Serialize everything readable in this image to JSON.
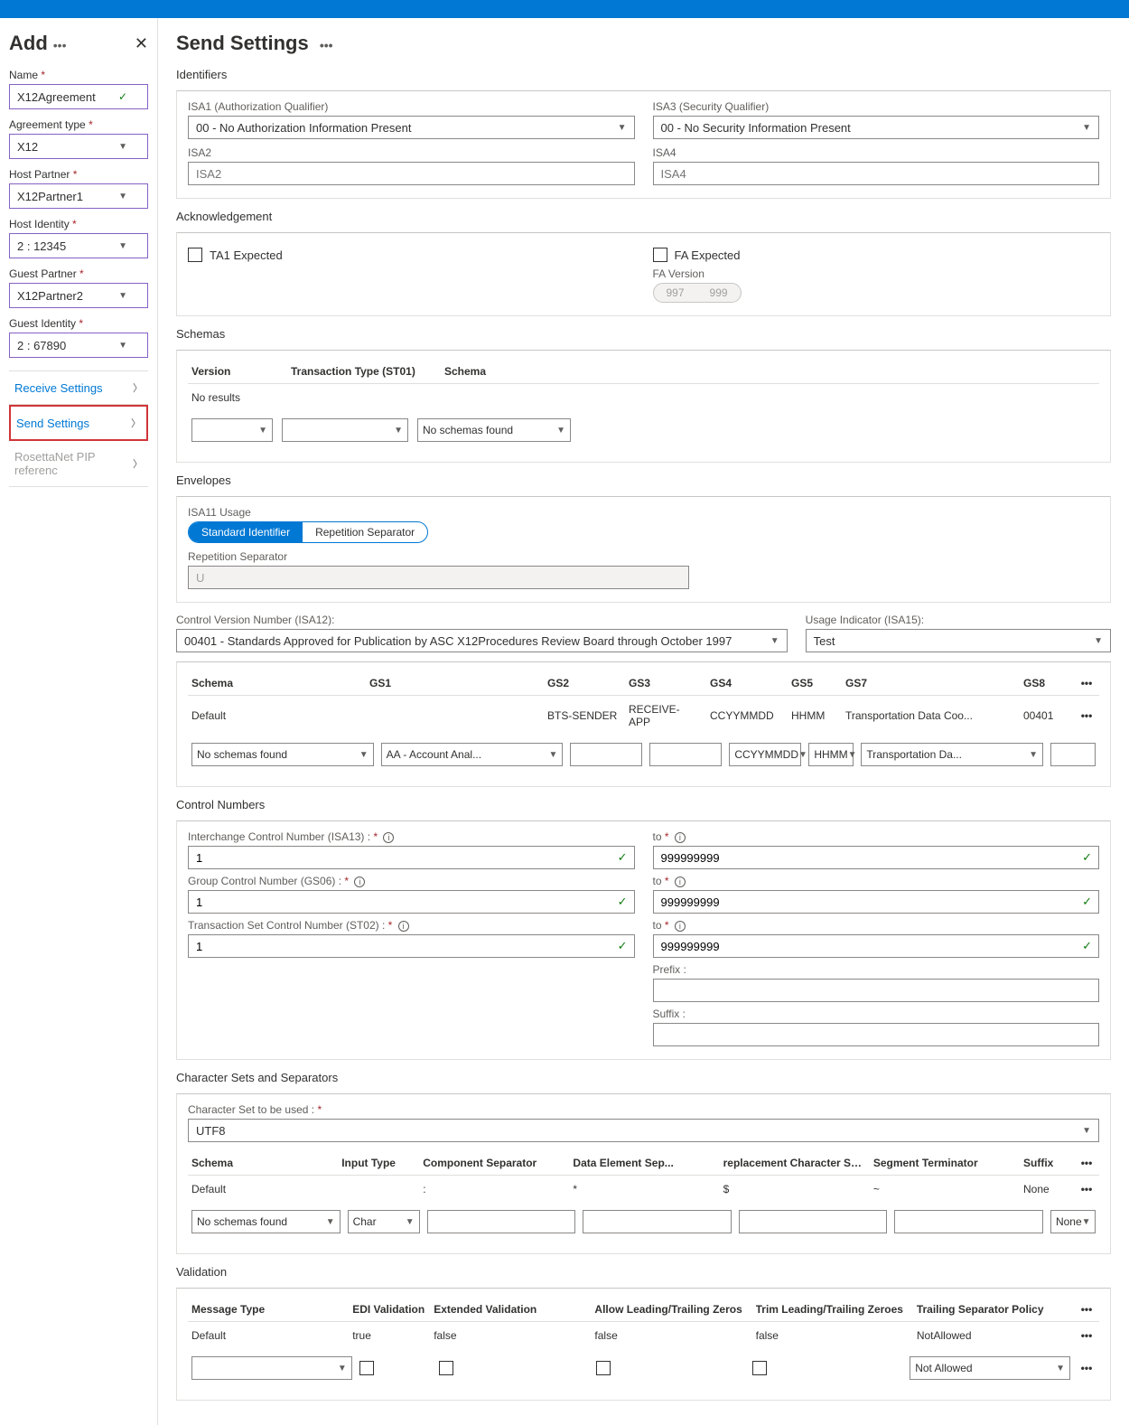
{
  "sidebar": {
    "title": "Add",
    "fields": {
      "name": {
        "label": "Name",
        "value": "X12Agreement"
      },
      "agreementType": {
        "label": "Agreement type",
        "value": "X12"
      },
      "hostPartner": {
        "label": "Host Partner",
        "value": "X12Partner1"
      },
      "hostIdentity": {
        "label": "Host Identity",
        "value": "2 : 12345"
      },
      "guestPartner": {
        "label": "Guest Partner",
        "value": "X12Partner2"
      },
      "guestIdentity": {
        "label": "Guest Identity",
        "value": "2 : 67890"
      }
    },
    "nav": {
      "receive": "Receive Settings",
      "send": "Send Settings",
      "rosetta": "RosettaNet PIP referenc"
    }
  },
  "page": {
    "title": "Send Settings"
  },
  "identifiers": {
    "title": "Identifiers",
    "isa1": {
      "label": "ISA1 (Authorization Qualifier)",
      "value": "00 - No Authorization Information Present"
    },
    "isa3": {
      "label": "ISA3 (Security Qualifier)",
      "value": "00 - No Security Information Present"
    },
    "isa2": {
      "label": "ISA2",
      "placeholder": "ISA2"
    },
    "isa4": {
      "label": "ISA4",
      "placeholder": "ISA4"
    }
  },
  "ack": {
    "title": "Acknowledgement",
    "ta1": "TA1 Expected",
    "fa": "FA Expected",
    "faVersion": "FA Version",
    "v997": "997",
    "v999": "999"
  },
  "schemas": {
    "title": "Schemas",
    "colVersion": "Version",
    "colTxn": "Transaction Type (ST01)",
    "colSchema": "Schema",
    "noResults": "No results",
    "noSchemas": "No schemas found"
  },
  "envelopes": {
    "title": "Envelopes",
    "isa11": "ISA11 Usage",
    "std": "Standard Identifier",
    "rep": "Repetition Separator",
    "repSep": "Repetition Separator",
    "repVal": "U",
    "cvn": "Control Version Number (ISA12):",
    "cvnVal": "00401 - Standards Approved for Publication by ASC X12Procedures Review Board through October 1997",
    "usage": "Usage Indicator (ISA15):",
    "usageVal": "Test",
    "cols": {
      "schema": "Schema",
      "gs1": "GS1",
      "gs2": "GS2",
      "gs3": "GS3",
      "gs4": "GS4",
      "gs5": "GS5",
      "gs7": "GS7",
      "gs8": "GS8"
    },
    "defaultRow": {
      "schema": "Default",
      "gs2": "BTS-SENDER",
      "gs3": "RECEIVE-APP",
      "gs4": "CCYYMMDD",
      "gs5": "HHMM",
      "gs7": "Transportation Data Coo...",
      "gs8": "00401"
    },
    "inputRow": {
      "schema": "No schemas found",
      "gs1": "AA - Account Anal...",
      "gs4": "CCYYMMDD",
      "gs5": "HHMM",
      "gs7": "Transportation Da..."
    }
  },
  "control": {
    "title": "Control Numbers",
    "isa13": "Interchange Control Number (ISA13) :",
    "gs06": "Group Control Number (GS06) :",
    "st02": "Transaction Set Control Number (ST02) :",
    "to": "to",
    "from": "1",
    "toVal": "999999999",
    "prefix": "Prefix :",
    "suffix": "Suffix :"
  },
  "charset": {
    "title": "Character Sets and Separators",
    "label": "Character Set to be used :",
    "value": "UTF8",
    "cols": {
      "schema": "Schema",
      "inputType": "Input Type",
      "comp": "Component Separator",
      "data": "Data Element Sep...",
      "repl": "replacement Character Sep...",
      "seg": "Segment Terminator",
      "suffix": "Suffix"
    },
    "defaultRow": {
      "schema": "Default",
      "comp": ":",
      "data": "*",
      "repl": "$",
      "seg": "~",
      "suffix": "None"
    },
    "inputRow": {
      "schema": "No schemas found",
      "inputType": "Char",
      "suffix": "None"
    }
  },
  "validation": {
    "title": "Validation",
    "cols": {
      "msg": "Message Type",
      "edi": "EDI Validation",
      "ext": "Extended Validation",
      "lead": "Allow Leading/Trailing Zeros",
      "trim": "Trim Leading/Trailing Zeroes",
      "trail": "Trailing Separator Policy"
    },
    "defaultRow": {
      "msg": "Default",
      "edi": "true",
      "ext": "false",
      "lead": "false",
      "trim": "false",
      "trail": "NotAllowed"
    },
    "inputRow": {
      "trail": "Not Allowed"
    }
  }
}
